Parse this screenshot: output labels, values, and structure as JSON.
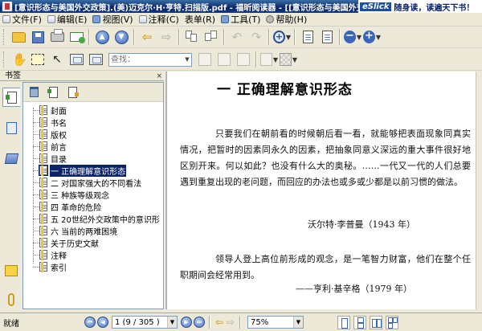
{
  "window": {
    "title": "[意识形态与美国外交政策].(美)迈克尔·H·亨特.扫描版.pdf - 福昕阅读器 - [[意识形态与美国外交",
    "ad_brand": "eSlick",
    "ad_text": "随身读，读遍天下书！"
  },
  "menu": {
    "items": [
      {
        "label": "文件(F)"
      },
      {
        "label": "编辑(E)"
      },
      {
        "label": "视图(V)"
      },
      {
        "label": "注释(C)"
      },
      {
        "label": "表单(R)"
      },
      {
        "label": "工具(T)"
      },
      {
        "label": "帮助(H)"
      }
    ]
  },
  "toolbar2": {
    "search_placeholder": "查找："
  },
  "left_panel": {
    "header": "书签",
    "close_glyph": "×",
    "bookmarks": [
      {
        "label": "封面"
      },
      {
        "label": "书名"
      },
      {
        "label": "版权"
      },
      {
        "label": "前言"
      },
      {
        "label": "目录"
      },
      {
        "label": "一 正确理解意识形态"
      },
      {
        "label": "二 对国家强大的不同看法"
      },
      {
        "label": "三 种族等级观念"
      },
      {
        "label": "四 革命的危险"
      },
      {
        "label": "五 20世纪外交政策中的意识形"
      },
      {
        "label": "六 当前的两难困境"
      },
      {
        "label": "关于历史文献"
      },
      {
        "label": "注释"
      },
      {
        "label": "索引"
      }
    ],
    "selected_index": 5
  },
  "document": {
    "chapter_title": "一   正确理解意识形态",
    "paragraph1": "只要我们在朝前看的时候朝后看一看，就能够把表面现象同真实情况，把暂时的因素同永久的因素，把抽象同意义深远的重大事件很好地区别开来。何以如此？也没有什么大的奥秘。……一代又一代的人们总要遇到重复出现的老问题，而回应的办法也或多或少都是以前习惯的做法。",
    "source1": "沃尔特·李普曼（1943 年）",
    "paragraph2": "领导人登上高位前形成的观念，是一笔智力财富，他们在整个任职期间会经常用到。",
    "source2": "——亨利·基辛格（1979 年）"
  },
  "statusbar": {
    "status": "就绪",
    "page_value": "1 (9 / 305 )",
    "zoom_value": "75%"
  },
  "colors": {
    "titlebar": "#0a246a",
    "selection": "#0a246a",
    "chrome": "#ece9d8",
    "doc_background": "#808080"
  }
}
